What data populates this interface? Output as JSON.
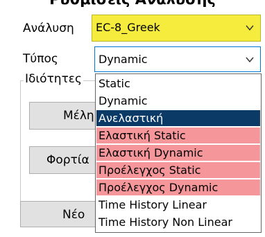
{
  "header": {
    "title": "Ρυθμίσεις Ανάλυσης"
  },
  "analysis": {
    "label": "Ανάλυση",
    "value": "EC-8_Greek"
  },
  "type": {
    "label": "Τύπος",
    "value": "Dynamic"
  },
  "properties": {
    "label": "Ιδιότητες",
    "members_button": "Μέλη",
    "loads_button": "Φορτία"
  },
  "new_button": "Νέο",
  "type_options": [
    {
      "label": "Static",
      "highlight": "none"
    },
    {
      "label": "Dynamic",
      "highlight": "none"
    },
    {
      "label": "Ανελαστική",
      "highlight": "selected"
    },
    {
      "label": "Ελαστική Static",
      "highlight": "pink"
    },
    {
      "label": "Ελαστική Dynamic",
      "highlight": "pink"
    },
    {
      "label": "Προέλεγχος Static",
      "highlight": "pink"
    },
    {
      "label": "Προέλεγχος Dynamic",
      "highlight": "pink"
    },
    {
      "label": "Time History Linear",
      "highlight": "none"
    },
    {
      "label": "Time History Non Linear",
      "highlight": "none"
    }
  ],
  "colors": {
    "analysis_field": "#f5ec3d",
    "highlight_pink": "#f5969a",
    "selected": "#0b3a67",
    "focus_border": "#0078d7"
  }
}
